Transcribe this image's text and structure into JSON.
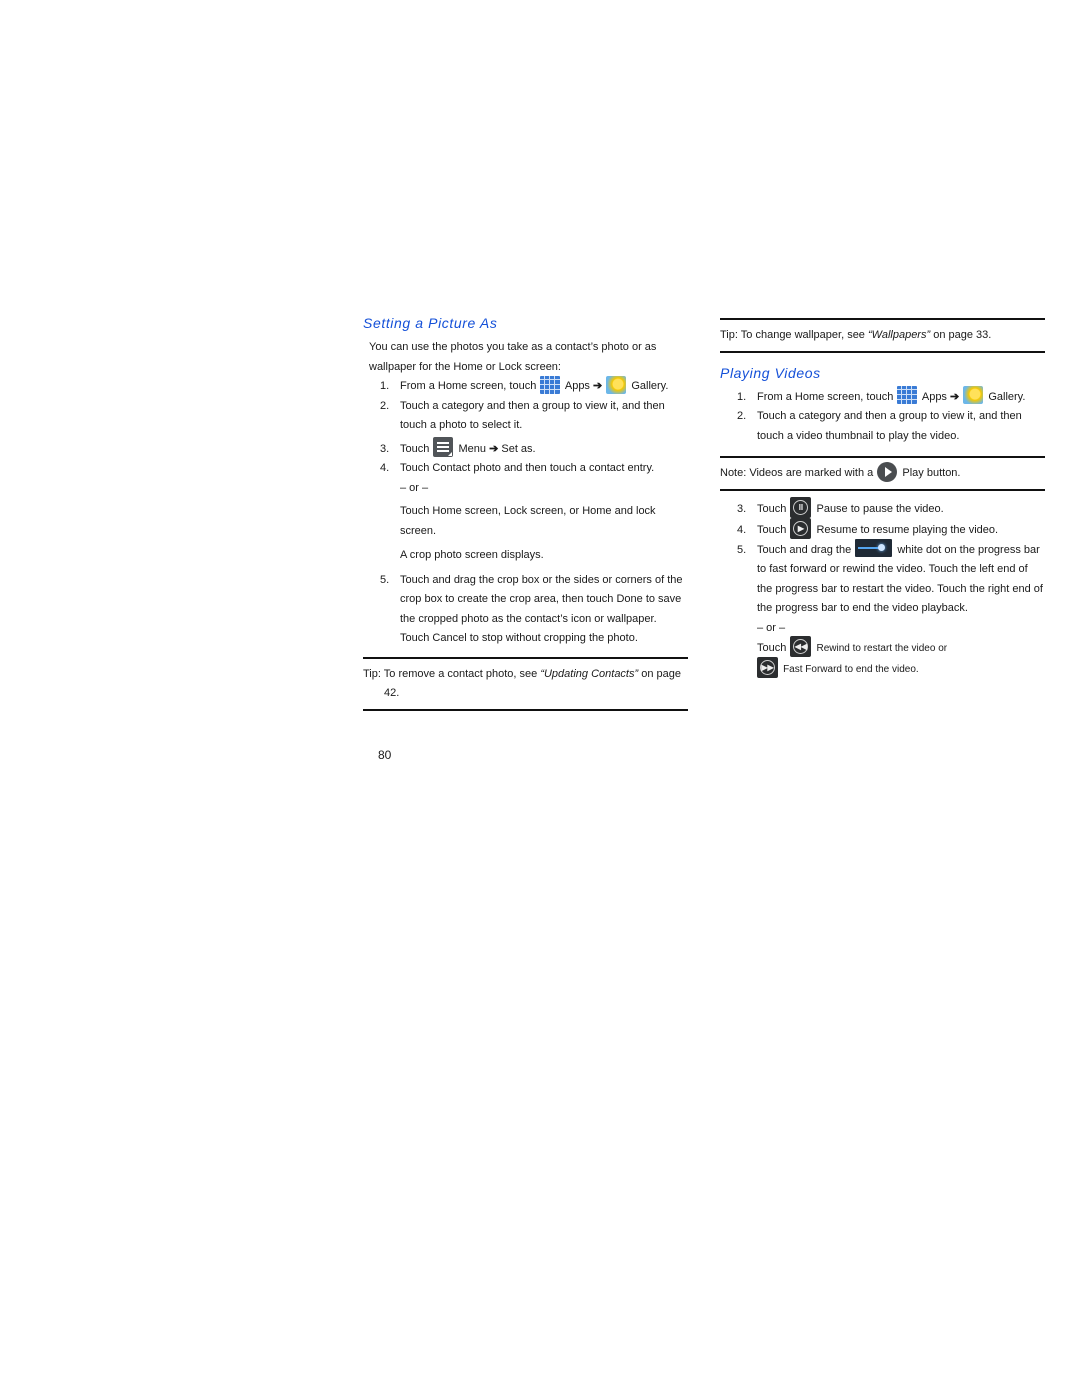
{
  "left_section": {
    "heading": "Setting a Picture As",
    "intro": "You can use the photos you take as a contact’s photo or as wallpaper for the Home or Lock screen:",
    "steps": [
      {
        "num": "1.",
        "pre": "From a Home screen, touch",
        "apps_label": "Apps",
        "arrow": "➔",
        "gallery_label": "Gallery."
      },
      {
        "num": "2.",
        "text": "Touch a category and then a group to view it, and then touch a photo to select it."
      },
      {
        "num": "3.",
        "pre": "Touch",
        "menu_label": "Menu",
        "arrow": "➔",
        "post": "Set as."
      },
      {
        "num": "4.",
        "text": "Touch Contact photo and then touch a contact entry.",
        "or": "– or –",
        "alt": "Touch Home screen, Lock screen, or Home and lock screen.",
        "result": "A crop photo screen displays."
      },
      {
        "num": "5.",
        "text": "Touch and drag the crop box or the sides or corners of the crop box to create the crop area, then touch Done to save the cropped photo as the contact’s icon or wallpaper. Touch Cancel to stop without cropping the photo."
      }
    ],
    "tip": {
      "prefix": "Tip: To remove a contact photo, see ",
      "link": "“Updating Contacts”",
      "suffix": " on page 42."
    }
  },
  "right_section": {
    "tip": {
      "prefix": "Tip: To change wallpaper, see ",
      "link": "“Wallpapers”",
      "suffix": " on page 33."
    },
    "heading": "Playing Videos",
    "steps": [
      {
        "num": "1.",
        "pre": "From a Home screen, touch",
        "apps_label": "Apps",
        "arrow": "➔",
        "gallery_label": "Gallery."
      },
      {
        "num": "2.",
        "text": "Touch a category and then a group to view it, and then touch a video thumbnail to play the video."
      }
    ],
    "note": {
      "pre": "Note: Videos are marked with a",
      "post": "Play button."
    },
    "steps2": [
      {
        "num": "3.",
        "pre": "Touch",
        "post": "Pause to pause the video."
      },
      {
        "num": "4.",
        "pre": "Touch",
        "post": "Resume to resume playing the video."
      },
      {
        "num": "5.",
        "pre": "Touch and drag the",
        "post": "white dot on the progress bar to fast forward or rewind the video. Touch the left end of the progress bar to restart the video. Touch the right end of the progress bar to end the video playback.",
        "or": "– or –",
        "rewind_pre": "Touch",
        "rewind_post": "Rewind to restart the video or",
        "ff_post": "Fast Forward to end the video."
      }
    ]
  },
  "page_number": "80"
}
